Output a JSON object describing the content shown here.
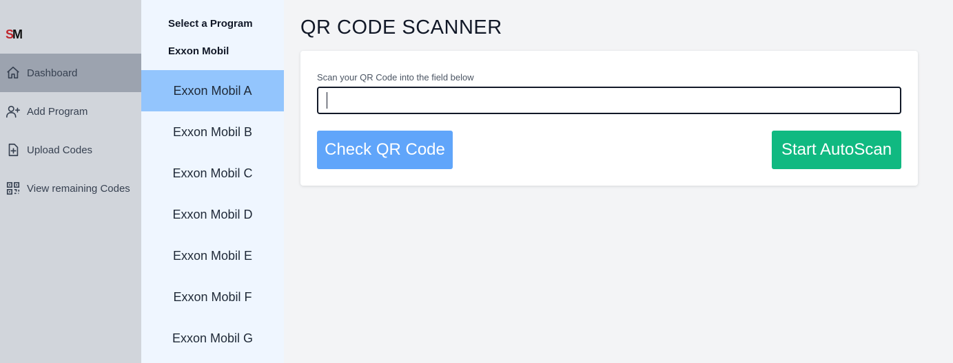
{
  "logo": {
    "text": "SM",
    "colors": {
      "s": "#c0272d",
      "m": "#111111"
    }
  },
  "nav": {
    "items": [
      {
        "label": "Dashboard",
        "icon": "home-icon",
        "active": true
      },
      {
        "label": "Add Program",
        "icon": "user-plus-icon",
        "active": false
      },
      {
        "label": "Upload Codes",
        "icon": "file-plus-icon",
        "active": false
      },
      {
        "label": "View remaining Codes",
        "icon": "qr-code-icon",
        "active": false
      }
    ]
  },
  "programs": {
    "title": "Select a Program",
    "group": "Exxon Mobil",
    "items": [
      {
        "label": "Exxon Mobil A",
        "active": true
      },
      {
        "label": "Exxon Mobil B",
        "active": false
      },
      {
        "label": "Exxon Mobil C",
        "active": false
      },
      {
        "label": "Exxon Mobil D",
        "active": false
      },
      {
        "label": "Exxon Mobil E",
        "active": false
      },
      {
        "label": "Exxon Mobil F",
        "active": false
      },
      {
        "label": "Exxon Mobil G",
        "active": false
      }
    ]
  },
  "main": {
    "title": "QR CODE SCANNER",
    "field_label": "Scan your QR Code into the field below",
    "input_value": "",
    "check_button": "Check QR Code",
    "autoscan_button": "Start AutoScan"
  },
  "colors": {
    "nav_bg": "#d1d5db",
    "nav_active": "#9ca3af",
    "programs_bg": "#eff6ff",
    "program_active": "#93c5fd",
    "check_button": "#60a5fa",
    "autoscan_button": "#10b981"
  }
}
